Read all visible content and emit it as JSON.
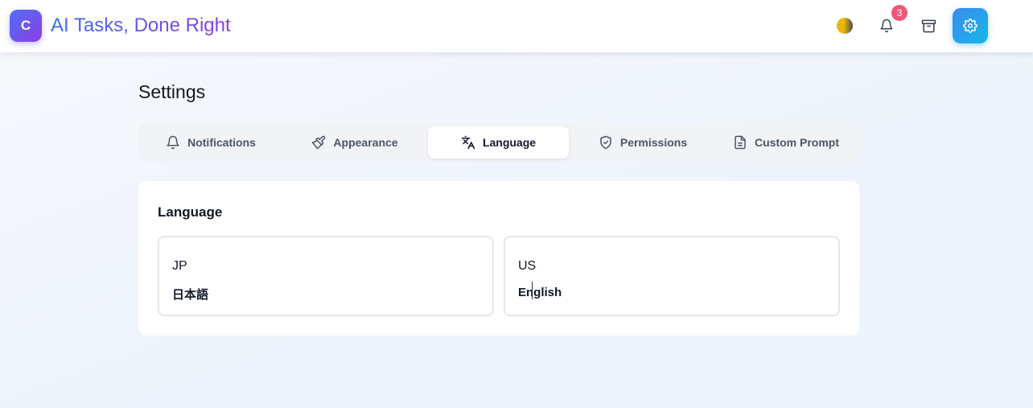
{
  "header": {
    "logo_letter": "C",
    "brand": "AI Tasks, Done Right",
    "notification_count": "3",
    "icons": [
      "theme-toggle-icon",
      "bell-icon",
      "archive-icon",
      "gear-icon"
    ],
    "colors": {
      "brand_start": "#3b6de8",
      "brand_end": "#8a3fe0",
      "badge": "#f0577a",
      "settings_button": "#3a8bf0"
    }
  },
  "page": {
    "title": "Settings"
  },
  "tabs": [
    {
      "label": "Notifications",
      "icon": "bell-icon",
      "active": false
    },
    {
      "label": "Appearance",
      "icon": "brush-icon",
      "active": false
    },
    {
      "label": "Language",
      "icon": "translate-icon",
      "active": true
    },
    {
      "label": "Permissions",
      "icon": "shield-check-icon",
      "active": false
    },
    {
      "label": "Custom Prompt",
      "icon": "document-icon",
      "active": false
    }
  ],
  "language_card": {
    "title": "Language",
    "options": [
      {
        "code": "JP",
        "name": "日本語"
      },
      {
        "code": "US",
        "name": "English"
      }
    ]
  }
}
